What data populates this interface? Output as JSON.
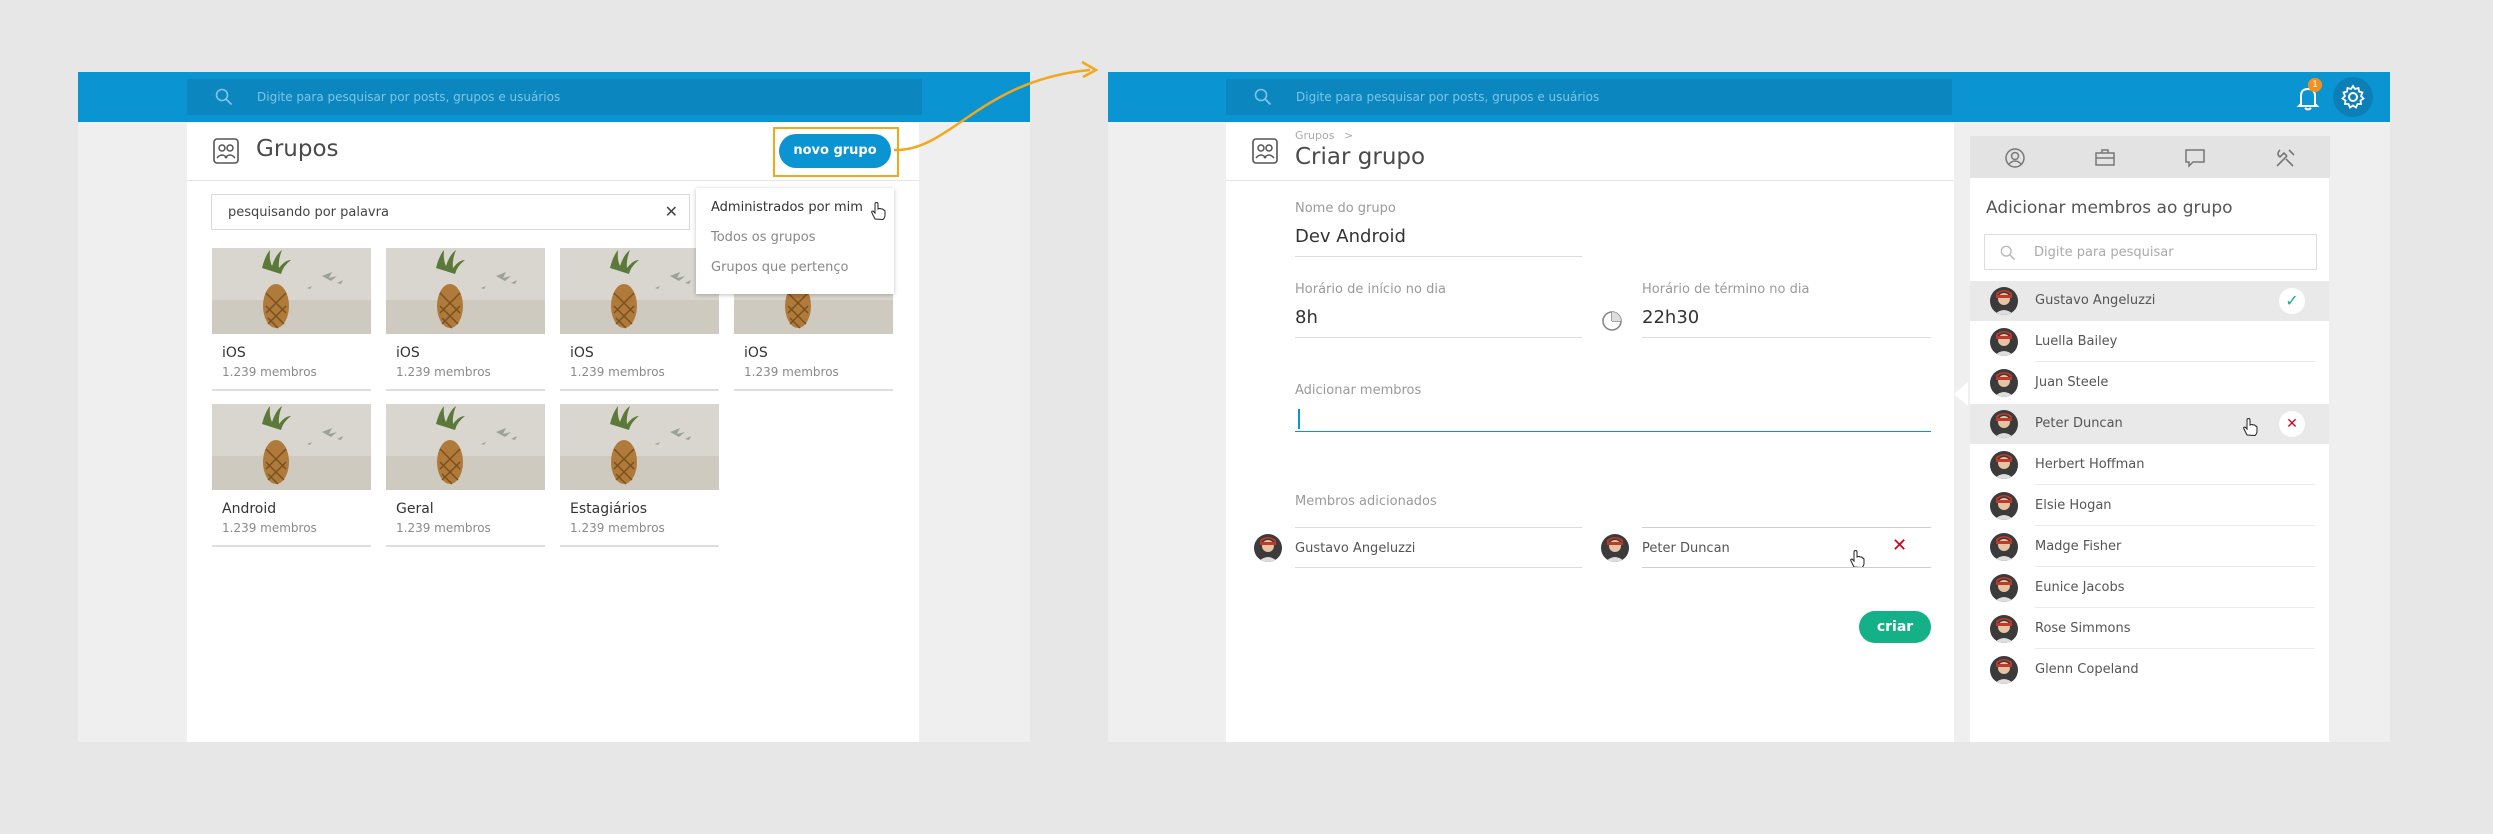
{
  "left_screen": {
    "search_placeholder": "Digite para pesquisar por posts, grupos e usuários",
    "page_title": "Grupos",
    "new_group_button": "novo grupo",
    "filter_input_value": "pesquisando por palavra",
    "clear_icon": "close-icon",
    "dropdown_items": [
      "Administrados por mim",
      "Todos os grupos",
      "Grupos que pertenço"
    ],
    "groups": [
      {
        "name": "iOS",
        "members": "1.239 membros"
      },
      {
        "name": "iOS",
        "members": "1.239 membros"
      },
      {
        "name": "iOS",
        "members": "1.239 membros"
      },
      {
        "name": "iOS",
        "members": "1.239 membros"
      },
      {
        "name": "Android",
        "members": "1.239 membros"
      },
      {
        "name": "Geral",
        "members": "1.239 membros"
      },
      {
        "name": "Estagiários",
        "members": "1.239 membros"
      }
    ]
  },
  "right_screen": {
    "search_placeholder": "Digite para pesquisar por posts, grupos e usuários",
    "notification_count": "1",
    "breadcrumb": "Grupos",
    "breadcrumb_separator": ">",
    "page_title": "Criar grupo",
    "form": {
      "group_name_label": "Nome do grupo",
      "group_name_value": "Dev Android",
      "start_time_label": "Horário de início no dia",
      "start_time_value": "8h",
      "end_time_label": "Horário de término no dia",
      "end_time_value": "22h30",
      "add_members_label": "Adicionar membros",
      "added_members_label": "Membros adicionados",
      "added_members": [
        "Gustavo Angeluzzi",
        "Peter Duncan"
      ],
      "create_button": "criar"
    },
    "sidebar": {
      "tabs": [
        "user-circle-icon",
        "briefcase-icon",
        "chat-icon",
        "tools-icon"
      ],
      "title": "Adicionar membros ao grupo",
      "search_placeholder": "Digite para pesquisar",
      "members": [
        {
          "name": "Gustavo Angeluzzi",
          "state": "selected"
        },
        {
          "name": "Luella Bailey",
          "state": ""
        },
        {
          "name": "Juan Steele",
          "state": ""
        },
        {
          "name": "Peter Duncan",
          "state": "remove"
        },
        {
          "name": "Herbert Hoffman",
          "state": ""
        },
        {
          "name": "Elsie Hogan",
          "state": ""
        },
        {
          "name": "Madge Fisher",
          "state": ""
        },
        {
          "name": "Eunice Jacobs",
          "state": ""
        },
        {
          "name": "Rose Simmons",
          "state": ""
        },
        {
          "name": "Glenn Copeland",
          "state": ""
        }
      ]
    }
  },
  "colors": {
    "topbar": "#0a94d2",
    "primary_button": "#0a94d2",
    "highlight": "#f2a81d",
    "create_button": "#14b188",
    "check": "#14b188",
    "remove": "#d0021b"
  }
}
